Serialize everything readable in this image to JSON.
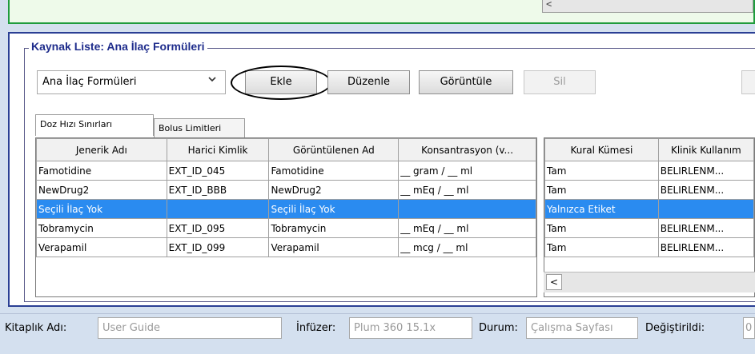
{
  "group_title": "Kaynak Liste: Ana İlaç Formüleri",
  "toolbar": {
    "formulary_selected": "Ana İlaç Formüleri",
    "ekle": "Ekle",
    "duzenle": "Düzenle",
    "goruntule": "Görüntüle",
    "sil": "Sil"
  },
  "tabs": [
    {
      "label": "Doz Hızı Sınırları",
      "active": true
    },
    {
      "label": "Bolus Limitleri",
      "active": false
    }
  ],
  "left_table": {
    "headers": [
      "Jenerik Adı",
      "Harici Kimlik",
      "Görüntülenen Ad",
      "Konsantrasyon (v..."
    ],
    "rows": [
      [
        "Famotidine",
        "EXT_ID_045",
        "Famotidine",
        "__ gram / __ ml"
      ],
      [
        "NewDrug2",
        "EXT_ID_BBB",
        "NewDrug2",
        "__ mEq / __ ml"
      ],
      [
        "Seçili İlaç Yok",
        "",
        "Seçili İlaç Yok",
        ""
      ],
      [
        "Tobramycin",
        "EXT_ID_095",
        "Tobramycin",
        "__ mEq / __ ml"
      ],
      [
        "Verapamil",
        "EXT_ID_099",
        "Verapamil",
        "__ mcg / __ ml"
      ]
    ],
    "selected_row": 2
  },
  "right_table": {
    "headers": [
      "Kural Kümesi",
      "Klinik Kullanım"
    ],
    "rows": [
      [
        "Tam",
        "BELIRLENM..."
      ],
      [
        "Tam",
        "BELIRLENM..."
      ],
      [
        "Yalnızca Etiket",
        ""
      ],
      [
        "Tam",
        "BELIRLENM..."
      ],
      [
        "Tam",
        "BELIRLENM..."
      ]
    ],
    "selected_row": 2
  },
  "status_bar": {
    "library_label": "Kitaplık Adı:",
    "library_value": "User Guide",
    "infuser_label": "İnfüzer:",
    "infuser_value": "Plum 360 15.1x",
    "state_label": "Durum:",
    "state_value": "Çalışma Sayfası",
    "modified_label": "Değiştirildi:",
    "modified_value": "0"
  },
  "icons": {
    "scroll_left": "‹",
    "chevron_down": "⌄"
  },
  "colors": {
    "selection": "#2a8bf0",
    "panel_border": "#2a3f94",
    "title": "#1f2d8c",
    "top_panel_border": "#1f9c3d"
  }
}
